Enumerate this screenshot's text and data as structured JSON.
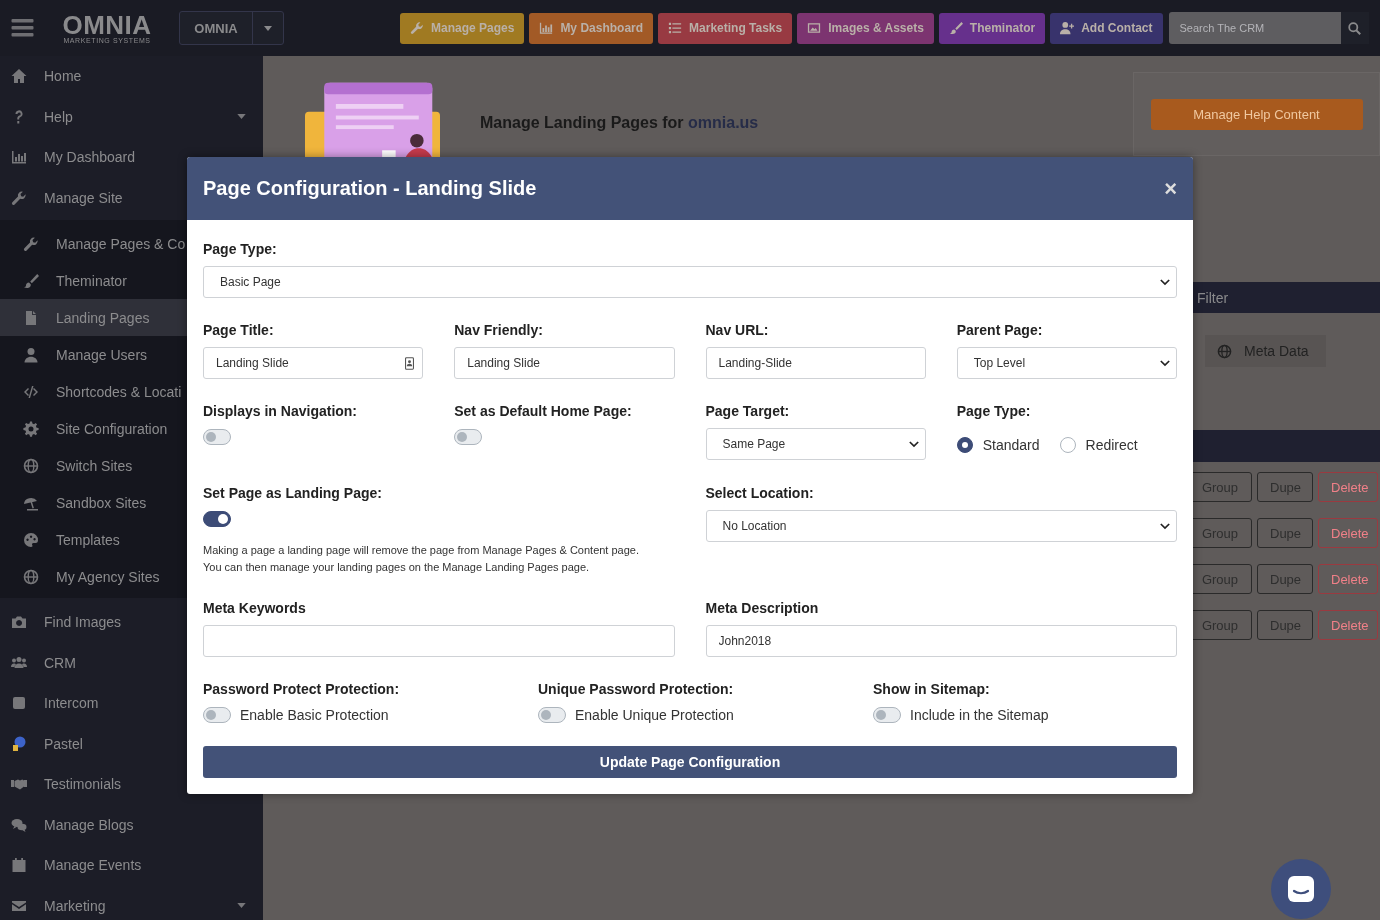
{
  "topbar": {
    "logo": {
      "name": "OMNIA",
      "tagline": "MARKETING SYSTEMS"
    },
    "site_switcher": "OMNIA",
    "buttons": [
      {
        "label": "Manage Pages",
        "color": "#a07a22"
      },
      {
        "label": "My Dashboard",
        "color": "#a25a26"
      },
      {
        "label": "Marketing Tasks",
        "color": "#983a42"
      },
      {
        "label": "Images & Assets",
        "color": "#7c3470"
      },
      {
        "label": "Theminator",
        "color": "#66308c"
      },
      {
        "label": "Add Contact",
        "color": "#38336c"
      }
    ],
    "search": {
      "placeholder": "Search The CRM"
    }
  },
  "sidebar": {
    "items": [
      {
        "label": "Home",
        "selected": false
      },
      {
        "label": "Help",
        "selected": false,
        "caret": true
      },
      {
        "label": "My Dashboard",
        "selected": false
      },
      {
        "label": "Manage Site",
        "selected": false,
        "children": [
          {
            "label": "Manage Pages & Co",
            "selected": false
          },
          {
            "label": "Theminator",
            "selected": false
          },
          {
            "label": "Landing Pages",
            "selected": true
          },
          {
            "label": "Manage Users",
            "selected": false
          },
          {
            "label": "Shortcodes & Locati",
            "selected": false
          },
          {
            "label": "Site Configuration",
            "selected": false
          },
          {
            "label": "Switch Sites",
            "selected": false
          },
          {
            "label": "Sandbox Sites",
            "selected": false
          },
          {
            "label": "Templates",
            "selected": false
          },
          {
            "label": "My Agency Sites",
            "selected": false
          }
        ]
      },
      {
        "label": "Find Images",
        "selected": false
      },
      {
        "label": "CRM",
        "selected": false
      },
      {
        "label": "Intercom",
        "selected": false
      },
      {
        "label": "Pastel",
        "selected": false
      },
      {
        "label": "Testimonials",
        "selected": false
      },
      {
        "label": "Manage Blogs",
        "selected": false
      },
      {
        "label": "Manage Events",
        "selected": false
      },
      {
        "label": "Marketing",
        "selected": false,
        "caret": true
      }
    ]
  },
  "page": {
    "intro": {
      "title": "Manage Landing Pages for",
      "site": "omnia.us"
    },
    "help_button": "Manage Help Content",
    "filter_bar": "Filter",
    "meta_chip": "Meta Data",
    "rows": [
      {
        "actions": [
          "Group",
          "Dupe",
          "Delete"
        ]
      },
      {
        "actions": [
          "Group",
          "Dupe",
          "Delete"
        ]
      },
      {
        "actions": [
          "Group",
          "Dupe",
          "Delete"
        ]
      },
      {
        "actions": [
          "Group",
          "Dupe",
          "Delete"
        ]
      }
    ]
  },
  "modal": {
    "title": "Page Configuration - Landing Slide",
    "close": "×",
    "rows": [
      [
        {
          "kind": "select",
          "label": "Page Type:",
          "value": "Basic Page"
        }
      ],
      [
        {
          "kind": "iconinput",
          "label": "Page Title:",
          "value": "Landing Slide"
        },
        {
          "kind": "input",
          "label": "Nav Friendly:",
          "value": "Landing Slide"
        },
        {
          "kind": "input",
          "label": "Nav URL:",
          "value": "Landing-Slide"
        },
        {
          "kind": "select",
          "label": "Parent Page:",
          "value": "Top Level"
        }
      ],
      [
        {
          "kind": "toggle",
          "label": "Displays in Navigation:",
          "on": false
        },
        {
          "kind": "toggle",
          "label": "Set as Default Home Page:",
          "on": false
        },
        {
          "kind": "select",
          "label": "Page Target:",
          "value": "Same Page"
        },
        {
          "kind": "radio",
          "label": "Page Type:",
          "options": [
            {
              "label": "Standard",
              "selected": true
            },
            {
              "label": "Redirect",
              "selected": false
            }
          ]
        }
      ],
      [
        {
          "kind": "toggle",
          "label": "Set Page as Landing Page:",
          "on": true,
          "note": "Making a page a landing page will remove the page from Manage Pages & Content page.\nYou can then manage your landing pages on the Manage Landing Pages page."
        },
        {
          "kind": "select",
          "label": "Select Location:",
          "value": "No Location"
        }
      ],
      [
        {
          "kind": "input",
          "label": "Meta Keywords"
        },
        {
          "kind": "input",
          "label": "Meta Description",
          "value": "John2018"
        }
      ],
      [
        {
          "kind": "toggle",
          "label": "Password Protect Protection:",
          "on": false,
          "text": "Enable Basic Protection"
        },
        {
          "kind": "toggle",
          "label": "Unique Password Protection:",
          "on": false,
          "text": "Enable Unique Protection"
        },
        {
          "kind": "toggle",
          "label": "Show in Sitemap:",
          "on": false,
          "text": "Include in the Sitemap"
        }
      ]
    ],
    "submit": "Update Page Configuration"
  }
}
